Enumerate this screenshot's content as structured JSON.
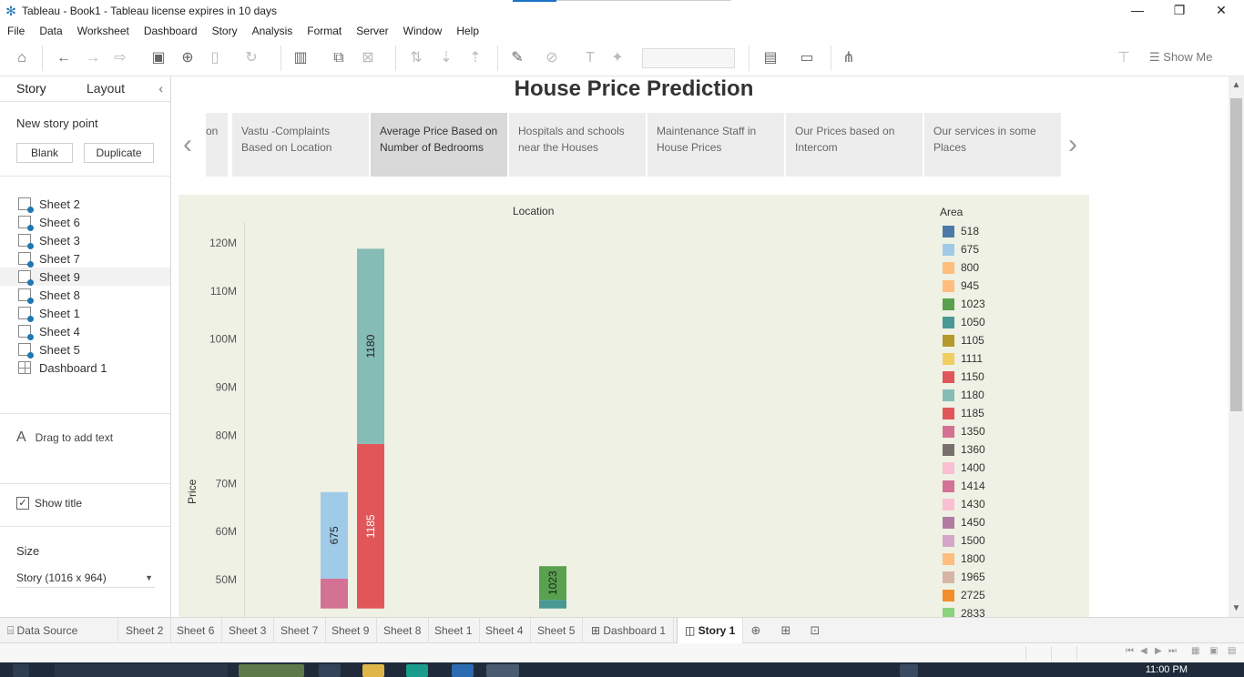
{
  "window": {
    "title": "Tableau - Book1 - Tableau license expires in 10 days",
    "minimize": "—",
    "restore": "❐",
    "close": "✕"
  },
  "menu": [
    "File",
    "Data",
    "Worksheet",
    "Dashboard",
    "Story",
    "Analysis",
    "Format",
    "Server",
    "Window",
    "Help"
  ],
  "toolbar": {
    "show_me": "Show Me"
  },
  "left_panel": {
    "tab_story": "Story",
    "tab_layout": "Layout",
    "collapse": "‹",
    "new_story_point": "New story point",
    "blank_button": "Blank",
    "duplicate_button": "Duplicate",
    "sheets": [
      {
        "label": "Sheet 2",
        "kind": "sheet"
      },
      {
        "label": "Sheet 6",
        "kind": "sheet"
      },
      {
        "label": "Sheet 3",
        "kind": "sheet"
      },
      {
        "label": "Sheet 7",
        "kind": "sheet"
      },
      {
        "label": "Sheet 9",
        "kind": "sheet"
      },
      {
        "label": "Sheet 8",
        "kind": "sheet"
      },
      {
        "label": "Sheet 1",
        "kind": "sheet"
      },
      {
        "label": "Sheet 4",
        "kind": "sheet"
      },
      {
        "label": "Sheet 5",
        "kind": "sheet"
      },
      {
        "label": "Dashboard 1",
        "kind": "dashboard"
      }
    ],
    "drag_icon": "A",
    "drag_text": "Drag to add text",
    "show_title_label": "Show title",
    "show_title_checked": "✓",
    "size_title": "Size",
    "size_value": "Story (1016 x 964)",
    "size_arrow": "▼"
  },
  "story": {
    "title": "House Price Prediction",
    "nav_prev": "‹",
    "nav_next": "›",
    "points": [
      {
        "label": "on",
        "active": false
      },
      {
        "label": "Vastu -Complaints Based on Location",
        "active": false
      },
      {
        "label": "Average Price Based on Number of Bedrooms",
        "active": true
      },
      {
        "label": "Hospitals and schools near the Houses",
        "active": false
      },
      {
        "label": "Maintenance Staff  in House Prices",
        "active": false
      },
      {
        "label": "Our  Prices based on Intercom",
        "active": false
      },
      {
        "label": "Our services in some Places",
        "active": false
      }
    ]
  },
  "chart_data": {
    "type": "bar",
    "stacked": true,
    "column_header": "Location",
    "ylabel": "Price",
    "ylim": [
      44,
      124
    ],
    "y_ticks": [
      "120M",
      "110M",
      "100M",
      "90M",
      "80M",
      "70M",
      "60M",
      "50M"
    ],
    "y_tick_values": [
      120,
      110,
      100,
      90,
      80,
      70,
      60,
      50
    ],
    "y_unit": "M",
    "bars": [
      {
        "segments": [
          {
            "area": "1350",
            "from": 44,
            "to": 50.2,
            "label": ""
          },
          {
            "area": "675",
            "from": 50.2,
            "to": 68.2,
            "label": "675"
          }
        ]
      },
      {
        "segments": [
          {
            "area": "1185",
            "from": 44,
            "to": 78.2,
            "label": "1185"
          },
          {
            "area": "1180",
            "from": 78.2,
            "to": 118.8,
            "label": "1180"
          }
        ]
      },
      {
        "segments": [
          {
            "area": "1050",
            "from": 44,
            "to": 45.8,
            "label": ""
          },
          {
            "area": "1023",
            "from": 45.8,
            "to": 52.8,
            "label": "1023"
          }
        ]
      }
    ],
    "legend_title": "Area",
    "legend": [
      {
        "label": "518",
        "color": "#4e79a7"
      },
      {
        "label": "675",
        "color": "#a0cbe8"
      },
      {
        "label": "800",
        "color": "#ffbe7d"
      },
      {
        "label": "945",
        "color": "#ffbe7d"
      },
      {
        "label": "1023",
        "color": "#59a14f"
      },
      {
        "label": "1050",
        "color": "#499894"
      },
      {
        "label": "1105",
        "color": "#b6992d"
      },
      {
        "label": "1111",
        "color": "#f1ce63"
      },
      {
        "label": "1150",
        "color": "#e15759"
      },
      {
        "label": "1180",
        "color": "#86bcb6"
      },
      {
        "label": "1185",
        "color": "#e15759"
      },
      {
        "label": "1350",
        "color": "#d37295"
      },
      {
        "label": "1360",
        "color": "#79706e"
      },
      {
        "label": "1400",
        "color": "#fabfd2"
      },
      {
        "label": "1414",
        "color": "#d37295"
      },
      {
        "label": "1430",
        "color": "#fabfd2"
      },
      {
        "label": "1450",
        "color": "#b07aa1"
      },
      {
        "label": "1500",
        "color": "#d4a6c8"
      },
      {
        "label": "1800",
        "color": "#ffbe7d"
      },
      {
        "label": "1965",
        "color": "#d7b5a6"
      },
      {
        "label": "2725",
        "color": "#f28e2b"
      },
      {
        "label": "2833",
        "color": "#8cd17d"
      }
    ]
  },
  "sheet_tabs": {
    "data_source": "Data Source",
    "tabs": [
      "Sheet 2",
      "Sheet 6",
      "Sheet 3",
      "Sheet 7",
      "Sheet 9",
      "Sheet 8",
      "Sheet 1",
      "Sheet 4",
      "Sheet 5",
      "Dashboard 1"
    ],
    "active": "Story 1"
  },
  "taskbar": {
    "clock": "11:00 PM"
  }
}
